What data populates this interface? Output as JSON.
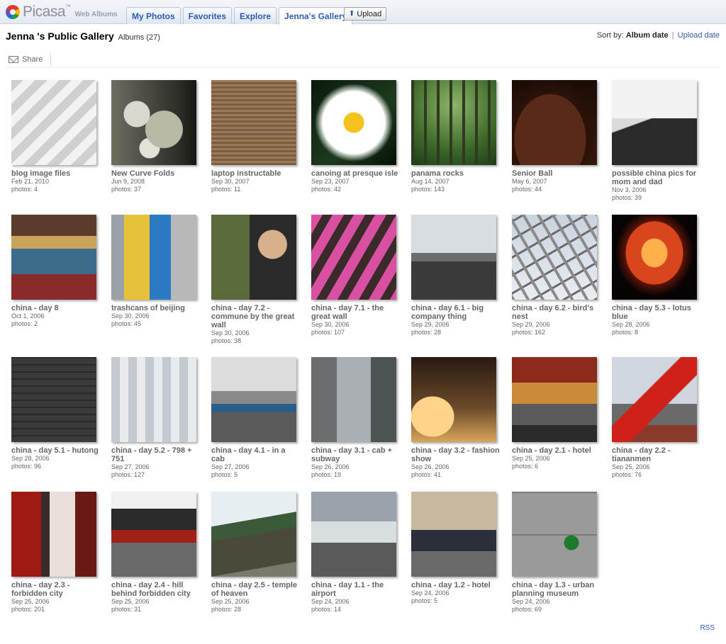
{
  "app": {
    "logo_name": "Picasa",
    "logo_tm": "™",
    "logo_sub": "Web Albums"
  },
  "tabs": [
    {
      "label": "My Photos",
      "active": false
    },
    {
      "label": "Favorites",
      "active": false
    },
    {
      "label": "Explore",
      "active": false
    },
    {
      "label": "Jenna's Gallery",
      "active": true
    }
  ],
  "upload_label": "Upload",
  "gallery": {
    "title": "Jenna 's Public Gallery",
    "albums_label": "Albums (27)"
  },
  "sort": {
    "label": "Sort by:",
    "current": "Album date",
    "separator": "|",
    "other": "Upload date"
  },
  "share_label": "Share",
  "rss_label": "RSS",
  "colors": {
    "link": "#2a5db0",
    "text": "#666666"
  },
  "albums": [
    {
      "title": "blog image files",
      "date": "Feb 21, 2010",
      "photos": "photos: 4",
      "thumb": "stripes"
    },
    {
      "title": "New Curve Folds",
      "date": "Jun 9, 2008",
      "photos": "photos: 37",
      "thumb": "folds"
    },
    {
      "title": "laptop instructable",
      "date": "Sep 30, 2007",
      "photos": "photos: 11",
      "thumb": "bag"
    },
    {
      "title": "canoing at presque isle",
      "date": "Sep 23, 2007",
      "photos": "photos: 42",
      "thumb": "lily"
    },
    {
      "title": "panama rocks",
      "date": "Aug 14, 2007",
      "photos": "photos: 143",
      "thumb": "forest"
    },
    {
      "title": "Senior Ball",
      "date": "May 6, 2007",
      "photos": "photos: 44",
      "thumb": "hair"
    },
    {
      "title": "possible china pics for mom and dad",
      "date": "Nov 3, 2006",
      "photos": "photos: 39",
      "thumb": "wall-sky"
    },
    {
      "title": "china - day 8",
      "date": "Oct 1, 2006",
      "photos": "photos: 2",
      "thumb": "shop"
    },
    {
      "title": "trashcans of beijing",
      "date": "Sep 30, 2006",
      "photos": "photos: 45",
      "thumb": "bins"
    },
    {
      "title": "china - day 7.2 - commune by the great wall",
      "date": "Sep 30, 2006",
      "photos": "photos: 38",
      "thumb": "camera-man"
    },
    {
      "title": "china - day 7.1 - the great wall",
      "date": "Sep 30, 2006",
      "photos": "photos: 107",
      "thumb": "pink"
    },
    {
      "title": "china - day 6.1 - big company thing",
      "date": "Sep 29, 2006",
      "photos": "photos: 28",
      "thumb": "table"
    },
    {
      "title": "china - day 6.2 - bird's nest",
      "date": "Sep 29, 2006",
      "photos": "photos: 162",
      "thumb": "nest"
    },
    {
      "title": "china - day 5.3 - lotus blue",
      "date": "Sep 28, 2006",
      "photos": "photos: 8",
      "thumb": "lamp"
    },
    {
      "title": "china - day 5.1 - hutong",
      "date": "Sep 28, 2006",
      "photos": "photos: 96",
      "thumb": "brick"
    },
    {
      "title": "china - day 5.2 - 798 + 751",
      "date": "Sep 27, 2006",
      "photos": "photos: 127",
      "thumb": "hall"
    },
    {
      "title": "china - day 4.1 - in a cab",
      "date": "Sep 27, 2006",
      "photos": "photos: 5",
      "thumb": "city"
    },
    {
      "title": "china - day 3.1 - cab + subway",
      "date": "Sep 26, 2006",
      "photos": "photos: 19",
      "thumb": "cab"
    },
    {
      "title": "china - day 3.2 - fashion show",
      "date": "Sep 26, 2006",
      "photos": "photos: 41",
      "thumb": "fashion"
    },
    {
      "title": "china - day 2.1 - hotel",
      "date": "Sep 25, 2006",
      "photos": "photos: 6",
      "thumb": "street"
    },
    {
      "title": "china - day 2.2 - tiananmen",
      "date": "Sep 25, 2006",
      "photos": "photos: 76",
      "thumb": "flag"
    },
    {
      "title": "china - day 2.3 - forbidden city",
      "date": "Sep 25, 2006",
      "photos": "photos: 201",
      "thumb": "red-corridor"
    },
    {
      "title": "china - day 2.4 - hill behind forbidden city",
      "date": "Sep 25, 2006",
      "photos": "photos: 31",
      "thumb": "pagoda"
    },
    {
      "title": "china - day 2.5 - temple of heaven",
      "date": "Sep 25, 2006",
      "photos": "photos: 28",
      "thumb": "roof"
    },
    {
      "title": "china - day 1.1 - the airport",
      "date": "Sep 24, 2006",
      "photos": "photos: 14",
      "thumb": "airport"
    },
    {
      "title": "china - day 1.2 - hotel",
      "date": "Sep 24, 2006",
      "photos": "photos: 5",
      "thumb": "car"
    },
    {
      "title": "china - day 1.3 - urban planning museum",
      "date": "Sep 24, 2006",
      "photos": "photos: 69",
      "thumb": "concrete"
    }
  ]
}
